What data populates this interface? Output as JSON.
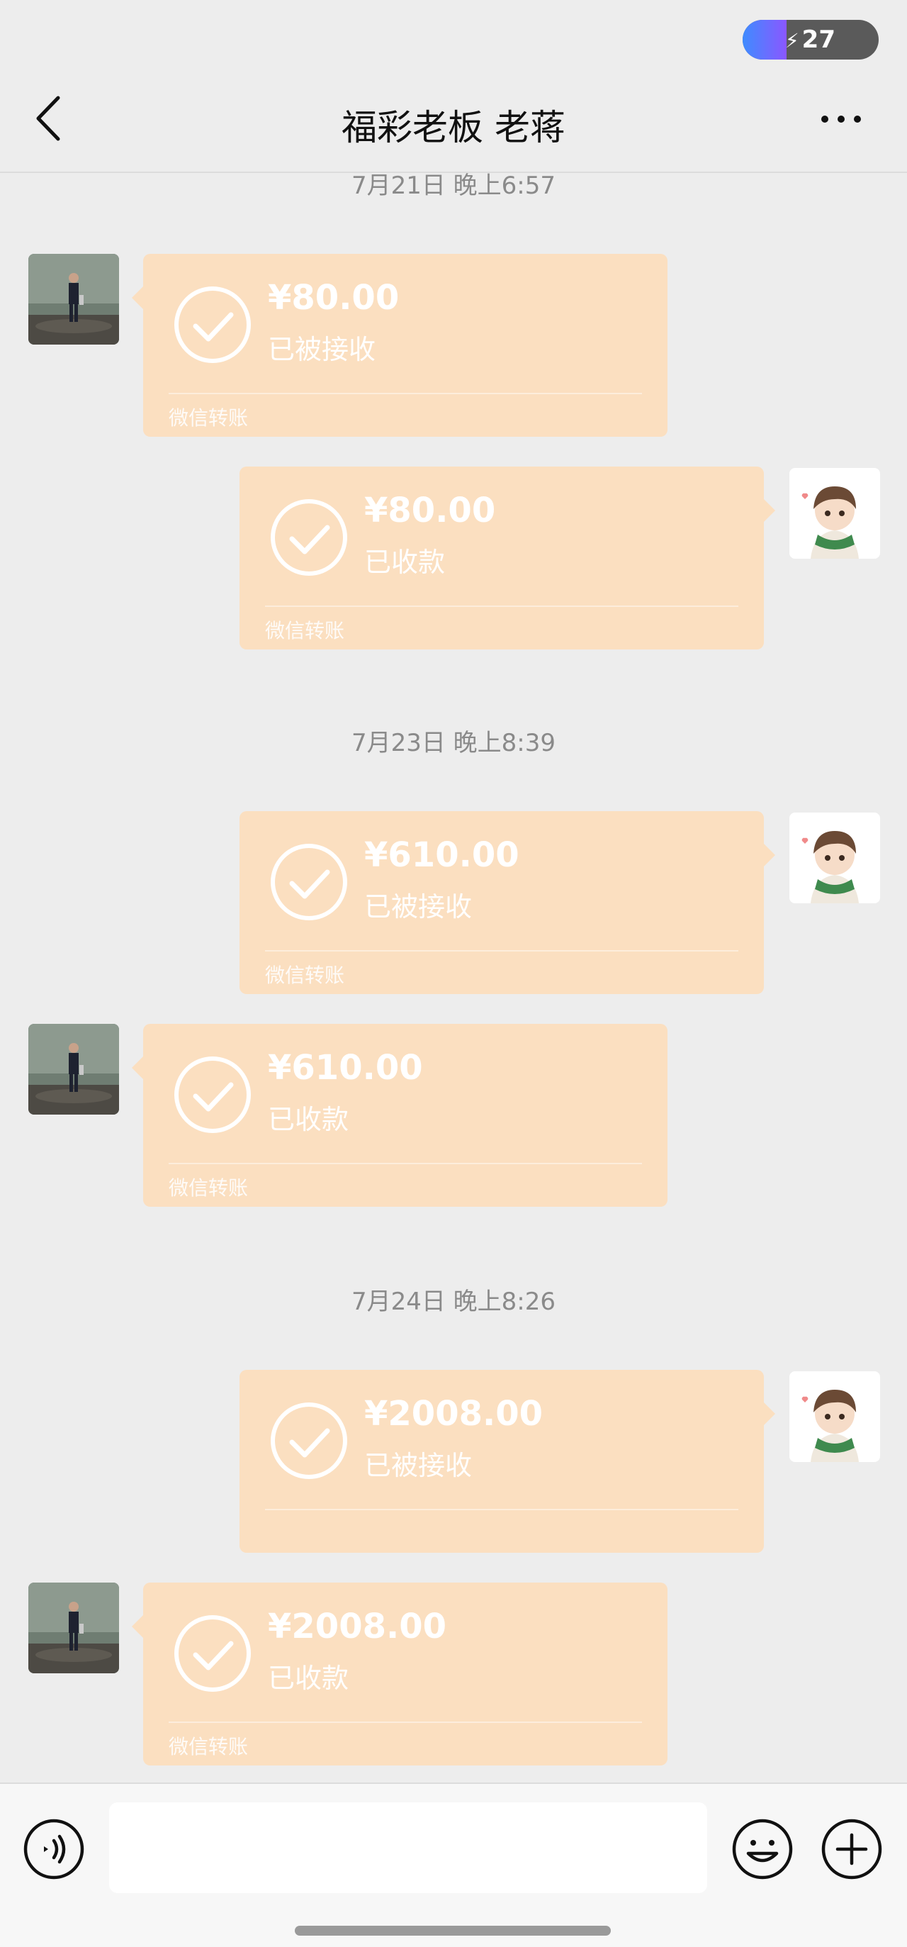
{
  "status_bar": {
    "battery_level": "27",
    "battery_icon": "charging-bolt-icon"
  },
  "nav": {
    "title": "福彩老板 老蒋",
    "back_icon": "chevron-left-icon",
    "more_icon": "more-dots-icon"
  },
  "messages": [
    {
      "timestamp": "7月21日 晚上6:57"
    },
    {
      "side": "left",
      "amount": "¥80.00",
      "status": "已被接收",
      "footer": "微信转账",
      "avatar": "contact-photo"
    },
    {
      "side": "right",
      "amount": "¥80.00",
      "status": "已收款",
      "footer": "微信转账",
      "avatar": "anime-boy-avatar"
    },
    {
      "timestamp": "7月23日 晚上8:39"
    },
    {
      "side": "right",
      "amount": "¥610.00",
      "status": "已被接收",
      "footer": "微信转账",
      "avatar": "anime-boy-avatar"
    },
    {
      "side": "left",
      "amount": "¥610.00",
      "status": "已收款",
      "footer": "微信转账",
      "avatar": "contact-photo"
    },
    {
      "timestamp": "7月24日 晚上8:26"
    },
    {
      "side": "right",
      "amount": "¥2008.00",
      "status": "已被接收",
      "footer": "",
      "avatar": "anime-boy-avatar"
    },
    {
      "side": "left",
      "amount": "¥2008.00",
      "status": "已收款",
      "footer": "微信转账",
      "avatar": "contact-photo"
    }
  ],
  "input_bar": {
    "voice_icon": "voice-input-icon",
    "input_value": "",
    "input_placeholder": "",
    "emoji_icon": "emoji-icon",
    "plus_icon": "plus-icon"
  },
  "colors": {
    "background": "#ededed",
    "transfer_bubble": "#fbdfc0",
    "timestamp_text": "#8a8a8a"
  }
}
